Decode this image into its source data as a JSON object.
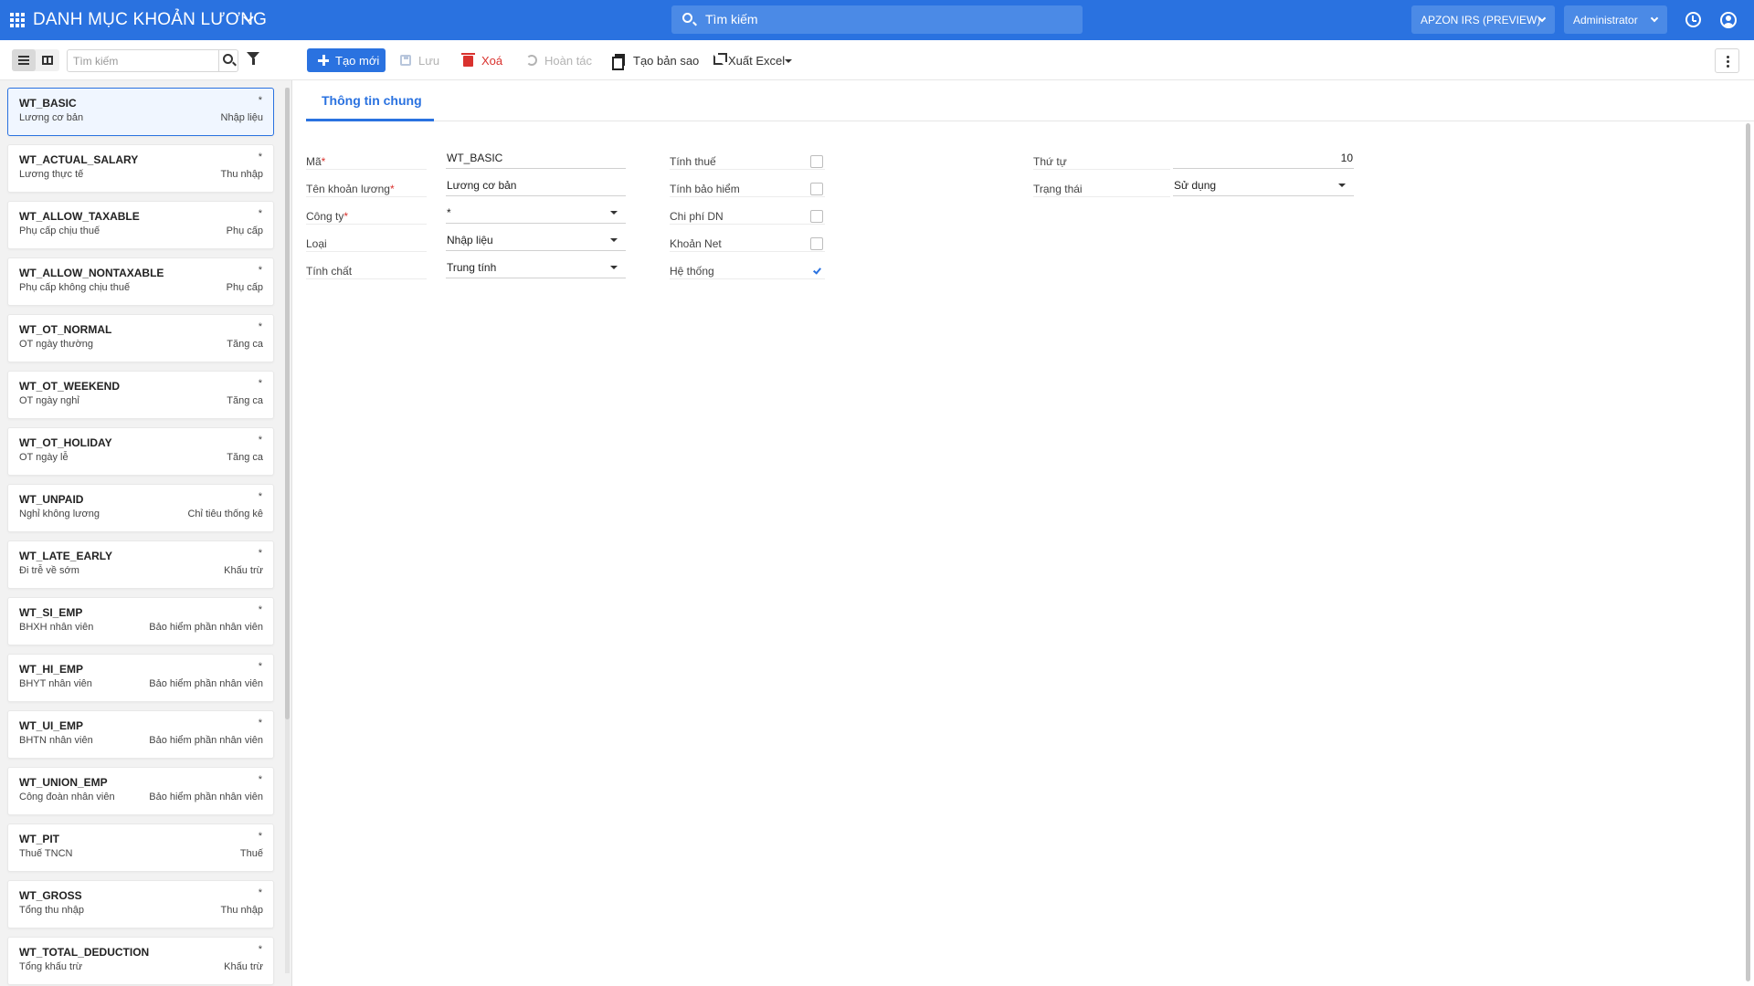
{
  "header": {
    "title": "DANH MỤC KHOẢN LƯƠNG",
    "search_placeholder": "Tìm kiếm",
    "company": "APZON IRS (PREVIEW)",
    "user": "Administrator",
    "accent": "#2a72e0"
  },
  "toolbar": {
    "search_placeholder": "Tìm kiếm",
    "create_label": "Tạo mới",
    "save_label": "Lưu",
    "delete_label": "Xoá",
    "undo_label": "Hoàn tác",
    "copy_label": "Tạo bản sao",
    "export_label": "Xuất Excel"
  },
  "sidebar": {
    "items": [
      {
        "code": "WT_BASIC",
        "name": "Lương cơ bản",
        "category": "Nhập liệu",
        "marker": "*"
      },
      {
        "code": "WT_ACTUAL_SALARY",
        "name": "Lương thực tế",
        "category": "Thu nhập",
        "marker": "*"
      },
      {
        "code": "WT_ALLOW_TAXABLE",
        "name": "Phụ cấp chịu thuế",
        "category": "Phụ cấp",
        "marker": "*"
      },
      {
        "code": "WT_ALLOW_NONTAXABLE",
        "name": "Phụ cấp không chịu thuế",
        "category": "Phụ cấp",
        "marker": "*"
      },
      {
        "code": "WT_OT_NORMAL",
        "name": "OT ngày thường",
        "category": "Tăng ca",
        "marker": "*"
      },
      {
        "code": "WT_OT_WEEKEND",
        "name": "OT ngày nghỉ",
        "category": "Tăng ca",
        "marker": "*"
      },
      {
        "code": "WT_OT_HOLIDAY",
        "name": "OT ngày lễ",
        "category": "Tăng ca",
        "marker": "*"
      },
      {
        "code": "WT_UNPAID",
        "name": "Nghỉ không lương",
        "category": "Chỉ tiêu thống kê",
        "marker": "*"
      },
      {
        "code": "WT_LATE_EARLY",
        "name": "Đi trễ về sớm",
        "category": "Khấu trừ",
        "marker": "*"
      },
      {
        "code": "WT_SI_EMP",
        "name": "BHXH nhân viên",
        "category": "Bảo hiểm phần nhân viên",
        "marker": "*"
      },
      {
        "code": "WT_HI_EMP",
        "name": "BHYT nhân viên",
        "category": "Bảo hiểm phần nhân viên",
        "marker": "*"
      },
      {
        "code": "WT_UI_EMP",
        "name": "BHTN nhân viên",
        "category": "Bảo hiểm phần nhân viên",
        "marker": "*"
      },
      {
        "code": "WT_UNION_EMP",
        "name": "Công đoàn nhân viên",
        "category": "Bảo hiểm phần nhân viên",
        "marker": "*"
      },
      {
        "code": "WT_PIT",
        "name": "Thuế TNCN",
        "category": "Thuế",
        "marker": "*"
      },
      {
        "code": "WT_GROSS",
        "name": "Tổng thu nhập",
        "category": "Thu nhập",
        "marker": "*"
      },
      {
        "code": "WT_TOTAL_DEDUCTION",
        "name": "Tổng khấu trừ",
        "category": "Khấu trừ",
        "marker": "*"
      }
    ]
  },
  "form": {
    "tab_label": "Thông tin chung",
    "required_marker": "*",
    "code_label": "Mã",
    "code_value": "WT_BASIC",
    "name_label": "Tên khoản lương",
    "name_value": "Lương cơ bản",
    "company_label": "Công ty",
    "company_value": "*",
    "type_label": "Loại",
    "type_value": "Nhập liệu",
    "nature_label": "Tính chất",
    "nature_value": "Trung tính",
    "tax_label": "Tính thuế",
    "tax_checked": false,
    "insurance_label": "Tính bảo hiểm",
    "insurance_checked": false,
    "cost_label": "Chi phí DN",
    "cost_checked": false,
    "net_label": "Khoản Net",
    "net_checked": false,
    "system_label": "Hệ thống",
    "system_checked": true,
    "order_label": "Thứ tự",
    "order_value": "10",
    "status_label": "Trạng thái",
    "status_value": "Sử dụng"
  }
}
